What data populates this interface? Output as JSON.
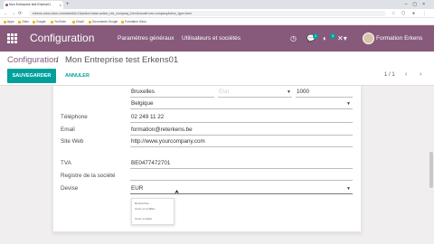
{
  "browser": {
    "tab_title": "Mon Entreprise test Erkens01",
    "url": "erkens-odoo.odoo.com/web#id=1&action=base.action_res_company_form&model=res.company&view_type=form",
    "bookmarks": [
      "Apps",
      "Odoo",
      "Google",
      "YouTube",
      "Gmail",
      "Documents Google",
      "Formation Odoo"
    ]
  },
  "navbar": {
    "brand": "Configuration",
    "menu_general": "Paramètres généraux",
    "menu_users": "Utilisateurs et sociétés",
    "chat_badge": "1",
    "activity_badge": "3",
    "username": "Formation Erkens"
  },
  "breadcrumb": {
    "parent": "Configuration",
    "separator": "/",
    "current": "Mon Entreprise test Erkens01"
  },
  "buttons": {
    "save": "SAUVEGARDER",
    "cancel": "ANNULER"
  },
  "pager": {
    "value": "1 / 1",
    "prev": "‹",
    "next": "›"
  },
  "form": {
    "city": "Bruxelles",
    "state_placeholder": "Etat",
    "zip": "1000",
    "country": "Belgique",
    "phone_label": "Téléphone",
    "phone": "02 249 11 22",
    "email_label": "Email",
    "email": "formation@reterkens.be",
    "website_label": "Site Web",
    "website": "http://www.yourcompany.com",
    "vat_label": "TVA",
    "vat": "BE0477472701",
    "registry_label": "Registre de la société",
    "currency_label": "Devise",
    "currency": "EUR"
  },
  "autocomplete": [
    "Rechercher...",
    "Créer et modifier...",
    "Créer et éditer"
  ]
}
